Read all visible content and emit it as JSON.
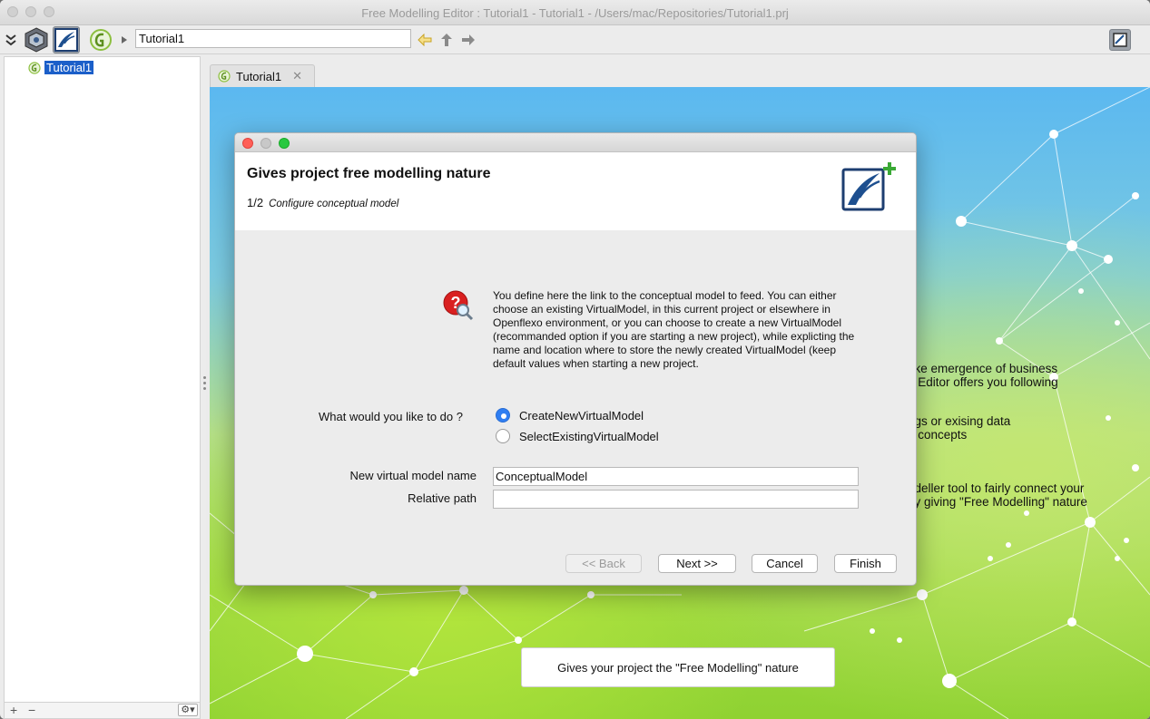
{
  "window": {
    "title": "Free Modelling Editor : Tutorial1 - Tutorial1 - /Users/mac/Repositories/Tutorial1.prj"
  },
  "toolbar": {
    "path_value": "Tutorial1"
  },
  "project_tree": {
    "root_label": "Tutorial1"
  },
  "editor": {
    "tab_label": "Tutorial1",
    "background_lines": [
      "ake emergence of business",
      "g Editor offers you following",
      "ngs or exising data",
      "g concepts",
      "odeller tool to fairly connect your",
      "by giving \"Free Modelling\" nature"
    ],
    "promo_button_label": "Gives your project the \"Free Modelling\" nature"
  },
  "dialog": {
    "title": "Gives project free modelling nature",
    "step": "1/2",
    "step_description": "Configure conceptual model",
    "description": "You define here the link to the conceptual model to feed. You can either choose an existing VirtualModel, in this current project or elsewhere in Openflexo environment, or you can choose to create a new VirtualModel (recommanded option if you are starting a new project), while explicting the name and location where to store the newly created VirtualModel (keep default values when starting a new project.",
    "question_label": "What would you like to do ?",
    "options": [
      {
        "label": "CreateNewVirtualModel",
        "selected": true
      },
      {
        "label": "SelectExistingVirtualModel",
        "selected": false
      }
    ],
    "name_label": "New virtual model name",
    "name_value": "ConceptualModel",
    "path_label": "Relative path",
    "path_value": "",
    "buttons": {
      "back": "<< Back",
      "next": "Next >>",
      "cancel": "Cancel",
      "finish": "Finish"
    }
  },
  "colors": {
    "selection_blue": "#1b5fc9",
    "radio_blue": "#2f7ef2",
    "close_red": "#ff5f57",
    "minimize_gray": "#c8c8c8",
    "zoom_green": "#28c840"
  }
}
